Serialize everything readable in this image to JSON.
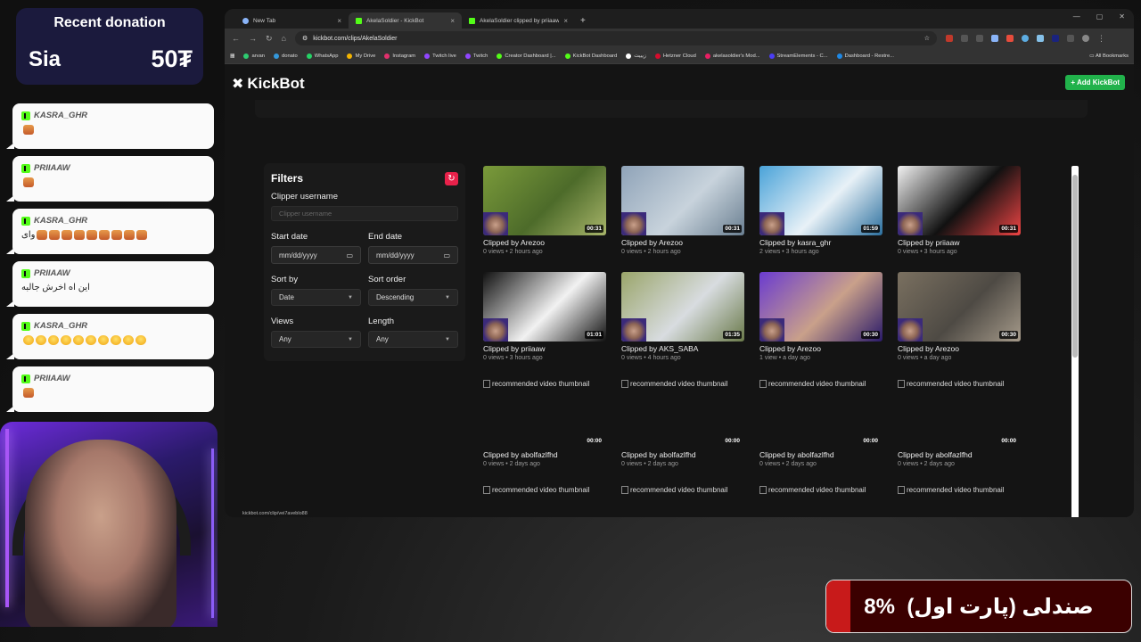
{
  "overlay": {
    "donation": {
      "title": "Recent donation",
      "name": "Sia",
      "amount": "50₮"
    },
    "chat": [
      {
        "user": "KASRA_GHR",
        "emotes": [
          "p"
        ],
        "text": ""
      },
      {
        "user": "PRIIAAW",
        "emotes": [
          "p"
        ],
        "text": ""
      },
      {
        "user": "KASRA_GHR",
        "text": "وای",
        "emotes": [
          "p",
          "p",
          "p",
          "p",
          "p",
          "p",
          "p",
          "p",
          "p"
        ]
      },
      {
        "user": "PRIIAAW",
        "text": "این اه اخرش جالبه",
        "emotes": []
      },
      {
        "user": "KASRA_GHR",
        "text": "",
        "emotes": [
          "y",
          "y",
          "y",
          "y",
          "y",
          "y",
          "y",
          "y",
          "y",
          "y"
        ]
      },
      {
        "user": "PRIIAAW",
        "text": "",
        "emotes": [
          "p"
        ]
      }
    ],
    "goal": {
      "text": "صندلی (پارت اول)",
      "percent_label": "8%",
      "progress": 0.08
    }
  },
  "browser": {
    "tabs": [
      {
        "title": "New Tab",
        "active": false,
        "icon": "chrome-icon"
      },
      {
        "title": "AkelaSoldier - KickBot",
        "active": true,
        "icon": "kick-icon"
      },
      {
        "title": "AkelaSoldier clipped by priiaaw",
        "active": false,
        "icon": "kick-icon"
      }
    ],
    "url": "kickbot.com/clips/AkelaSoldier",
    "bookmarks": [
      "arvan",
      "donato",
      "WhatsApp",
      "My Drive",
      "Instagram",
      "Twitch live",
      "Twitch",
      "Creator Dashboard |...",
      "KickBot Dashboard",
      "زیبیت",
      "Hetzner Cloud",
      "akelasoldier's Mod...",
      "StreamElements - C...",
      "Dashboard - Restre..."
    ],
    "all_bookmarks": "All Bookmarks",
    "status_url": "kickbot.com/clip/vei7aveblo88"
  },
  "kickbot": {
    "brand": "KickBot",
    "add_button": "+ Add KickBot",
    "filters": {
      "title": "Filters",
      "clipper_label": "Clipper username",
      "clipper_placeholder": "Clipper username",
      "start_label": "Start date",
      "end_label": "End date",
      "date_placeholder": "mm/dd/yyyy",
      "sort_by_label": "Sort by",
      "sort_by_value": "Date",
      "sort_order_label": "Sort order",
      "sort_order_value": "Descending",
      "views_label": "Views",
      "views_value": "Any",
      "length_label": "Length",
      "length_value": "Any"
    },
    "clips": [
      {
        "title": "Clipped by Arezoo",
        "meta": "0 views • 2 hours ago",
        "duration": "00:31",
        "colors": [
          "#7a9a3a",
          "#4d6b2a",
          "#a8b56a"
        ]
      },
      {
        "title": "Clipped by Arezoo",
        "meta": "0 views • 2 hours ago",
        "duration": "00:31",
        "colors": [
          "#8fa3b8",
          "#c8d3dc",
          "#6a7f91"
        ]
      },
      {
        "title": "Clipped by kasra_ghr",
        "meta": "2 views • 3 hours ago",
        "duration": "01:59",
        "colors": [
          "#4aa3d9",
          "#e8f1f7",
          "#2b6f9e"
        ]
      },
      {
        "title": "Clipped by priiaaw",
        "meta": "0 views • 3 hours ago",
        "duration": "00:31",
        "colors": [
          "#f2f2f2",
          "#111111",
          "#e44"
        ]
      },
      {
        "title": "Clipped by priiaaw",
        "meta": "0 views • 3 hours ago",
        "duration": "01:01",
        "colors": [
          "#111111",
          "#f2f2f2",
          "#111111"
        ]
      },
      {
        "title": "Clipped by AKS_SABA",
        "meta": "0 views • 4 hours ago",
        "duration": "01:35",
        "colors": [
          "#9aa56a",
          "#d8dce0",
          "#6a7a4a"
        ]
      },
      {
        "title": "Clipped by Arezoo",
        "meta": "1 view • a day ago",
        "duration": "00:30",
        "colors": [
          "#6a3bd0",
          "#c9a08a",
          "#2a1a6a"
        ]
      },
      {
        "title": "Clipped by Arezoo",
        "meta": "0 views • a day ago",
        "duration": "00:30",
        "colors": [
          "#7a7060",
          "#4e4a44",
          "#a59a8a"
        ]
      },
      {
        "title": "Clipped by abolfazlfhd",
        "meta": "0 views • 2 days ago",
        "duration": "00:00",
        "alt": "recommended video thumbnail"
      },
      {
        "title": "Clipped by abolfazlfhd",
        "meta": "0 views • 2 days ago",
        "duration": "00:00",
        "alt": "recommended video thumbnail"
      },
      {
        "title": "Clipped by abolfazlfhd",
        "meta": "0 views • 2 days ago",
        "duration": "00:00",
        "alt": "recommended video thumbnail"
      },
      {
        "title": "Clipped by abolfazlfhd",
        "meta": "0 views • 2 days ago",
        "duration": "00:00",
        "alt": "recommended video thumbnail"
      },
      {
        "title": "",
        "meta": "",
        "duration": "",
        "alt": "recommended video thumbnail"
      },
      {
        "title": "",
        "meta": "",
        "duration": "",
        "alt": "recommended video thumbnail"
      },
      {
        "title": "",
        "meta": "",
        "duration": "",
        "alt": "recommended video thumbnail"
      },
      {
        "title": "",
        "meta": "",
        "duration": "",
        "alt": "recommended video thumbnail"
      }
    ]
  }
}
